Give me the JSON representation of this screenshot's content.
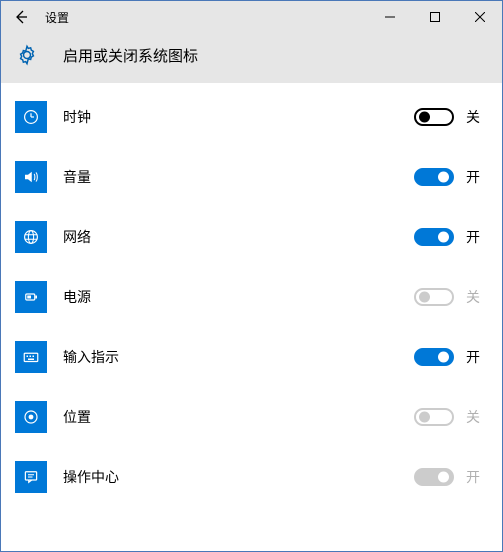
{
  "window": {
    "title": "设置"
  },
  "page": {
    "title": "启用或关闭系统图标"
  },
  "labels": {
    "on": "开",
    "off": "关"
  },
  "items": [
    {
      "key": "clock",
      "label": "时钟",
      "state": "off",
      "state_text": "关",
      "icon": "clock"
    },
    {
      "key": "volume",
      "label": "音量",
      "state": "on",
      "state_text": "开",
      "icon": "volume"
    },
    {
      "key": "network",
      "label": "网络",
      "state": "on",
      "state_text": "开",
      "icon": "network"
    },
    {
      "key": "power",
      "label": "电源",
      "state": "disabled-off",
      "state_text": "关",
      "icon": "power"
    },
    {
      "key": "ime",
      "label": "输入指示",
      "state": "on",
      "state_text": "开",
      "icon": "keyboard"
    },
    {
      "key": "location",
      "label": "位置",
      "state": "disabled-off",
      "state_text": "关",
      "icon": "location"
    },
    {
      "key": "action",
      "label": "操作中心",
      "state": "forced-on",
      "state_text": "开",
      "icon": "action"
    }
  ]
}
